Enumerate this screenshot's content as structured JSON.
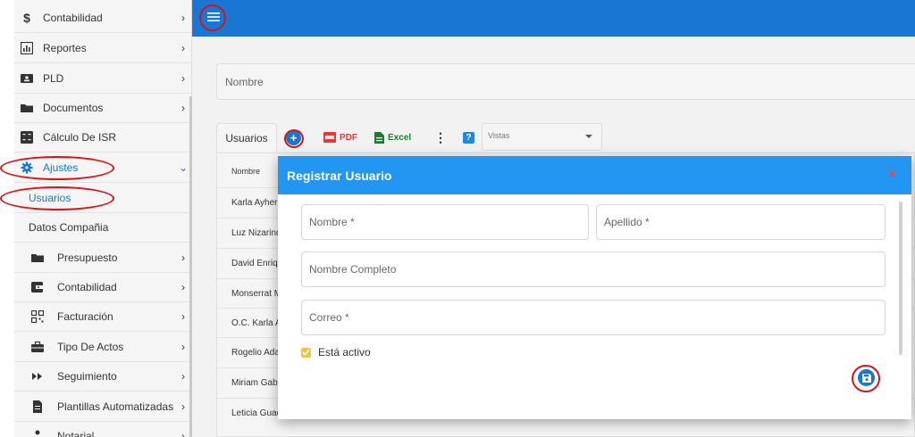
{
  "sidebar": {
    "items": [
      {
        "label": "Contabilidad",
        "icon": "dollar-icon"
      },
      {
        "label": "Reportes",
        "icon": "bar-chart-icon"
      },
      {
        "label": "PLD",
        "icon": "id-card-icon"
      },
      {
        "label": "Documentos",
        "icon": "folder-icon"
      },
      {
        "label": "Cálculo De ISR",
        "icon": "calculator-icon"
      },
      {
        "label": "Ajustes",
        "icon": "gear-icon"
      },
      {
        "label": "Usuarios"
      },
      {
        "label": "Datos Compañia"
      },
      {
        "label": "Presupuesto",
        "icon": "folder-icon"
      },
      {
        "label": "Contabilidad",
        "icon": "wallet-icon"
      },
      {
        "label": "Facturación",
        "icon": "qr-code-icon"
      },
      {
        "label": "Tipo De Actos",
        "icon": "briefcase-icon"
      },
      {
        "label": "Seguimiento",
        "icon": "fast-forward-icon"
      },
      {
        "label": "Plantillas Automatizadas",
        "icon": "document-icon"
      },
      {
        "label": "Notarial",
        "icon": "person-icon"
      }
    ]
  },
  "filter": {
    "placeholder": "Nombre"
  },
  "toolbar": {
    "tab_label": "Usuarios",
    "add_label": "+",
    "pdf_label": "PDF",
    "excel_label": "Excel",
    "help_label": "?",
    "vistas_label": "Vistas"
  },
  "table": {
    "header": "Nombre",
    "rows": [
      "Karla Ayheri",
      "Luz Nizarind",
      "David Enriqu",
      "Monserrat M",
      "O.C. Karla Ay",
      "Rogelio Ada",
      "Miriam Gabr",
      "Leticia Guad"
    ]
  },
  "modal": {
    "title": "Registrar Usuario",
    "close_label": "×",
    "fields": {
      "nombre": "Nombre *",
      "apellido": "Apellido *",
      "nombre_completo": "Nombre Completo",
      "correo": "Correo *"
    },
    "active_label": "Está activo"
  },
  "colors": {
    "primary": "#1976d2",
    "header": "#2196f3",
    "annotation": "#d8141b",
    "checkbox": "#f6c244"
  }
}
